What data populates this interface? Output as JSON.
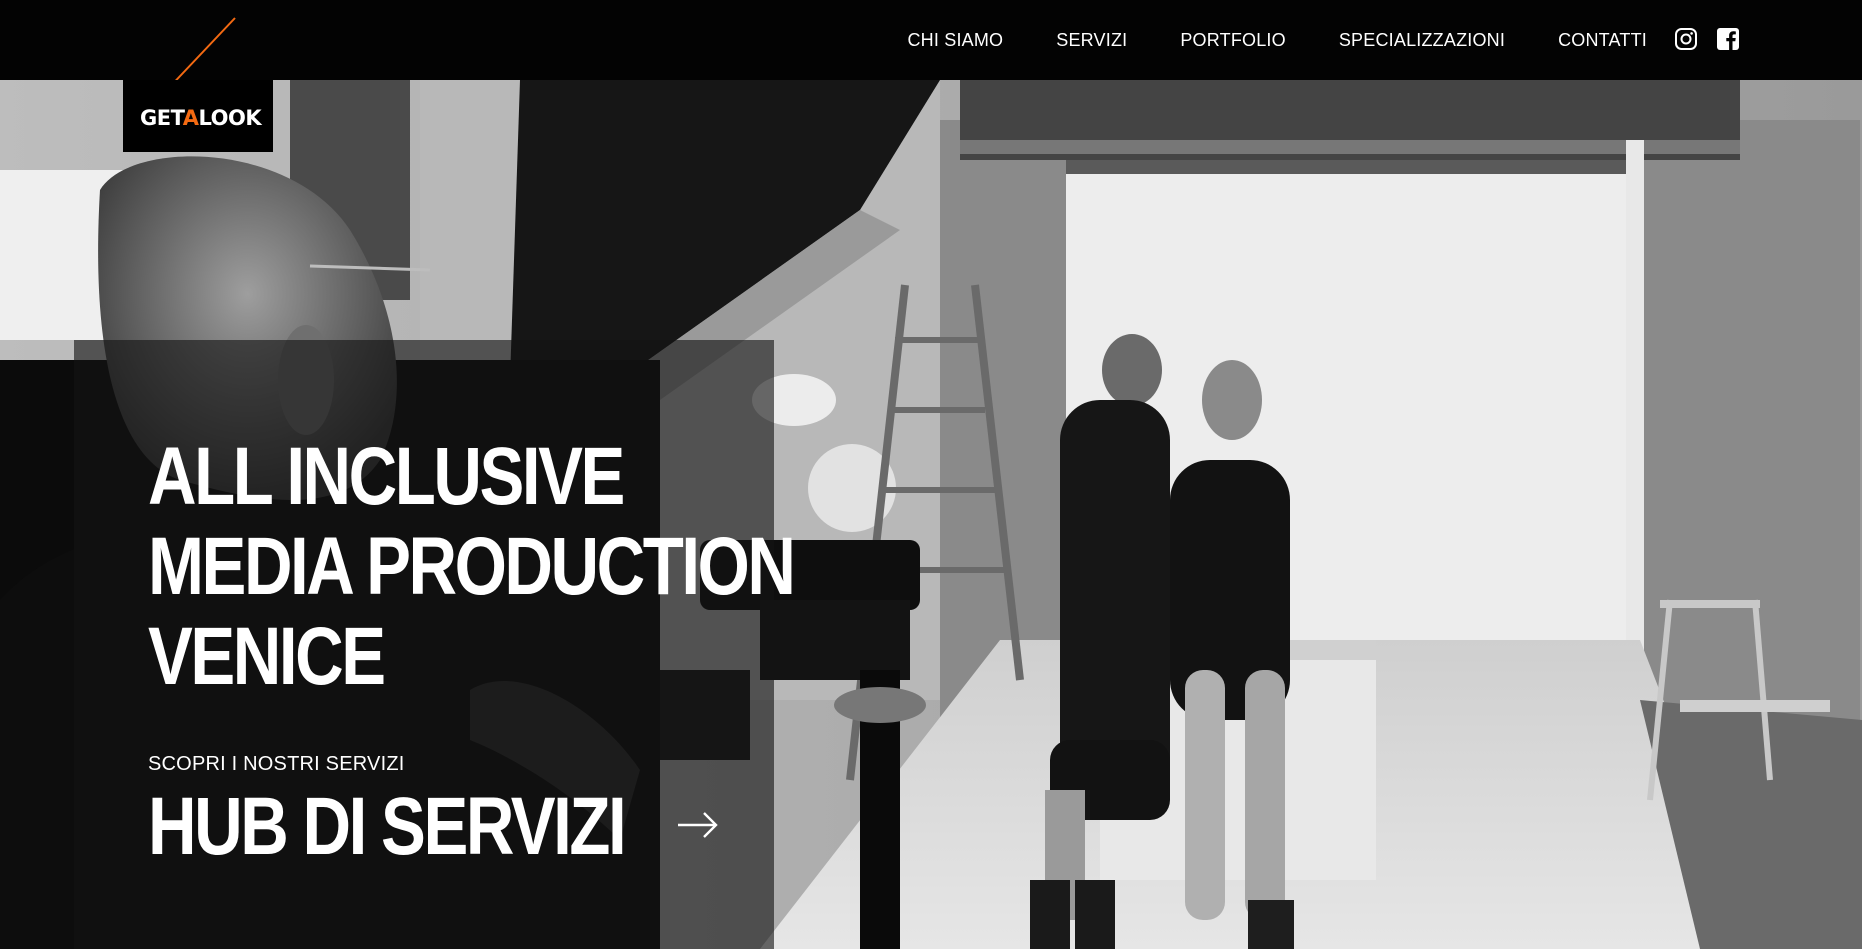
{
  "brand": {
    "logo_text_pre": "GET",
    "logo_text_accent": "A",
    "logo_text_post": "LOOK",
    "accent_color": "#f46a12"
  },
  "nav": {
    "items": [
      {
        "label": "CHI SIAMO"
      },
      {
        "label": "SERVIZI"
      },
      {
        "label": "PORTFOLIO"
      },
      {
        "label": "SPECIALIZZAZIONI"
      },
      {
        "label": "CONTATTI"
      }
    ],
    "social": [
      {
        "icon": "instagram-icon"
      },
      {
        "icon": "facebook-icon"
      }
    ]
  },
  "hero": {
    "title_lines": [
      "ALL INCLUSIVE",
      "MEDIA PRODUCTION",
      "VENICE"
    ],
    "cta_small": "SCOPRI I NOSTRI SERVIZI",
    "cta_big": "HUB DI SERVIZI",
    "cta_icon": "arrow-right-icon"
  }
}
